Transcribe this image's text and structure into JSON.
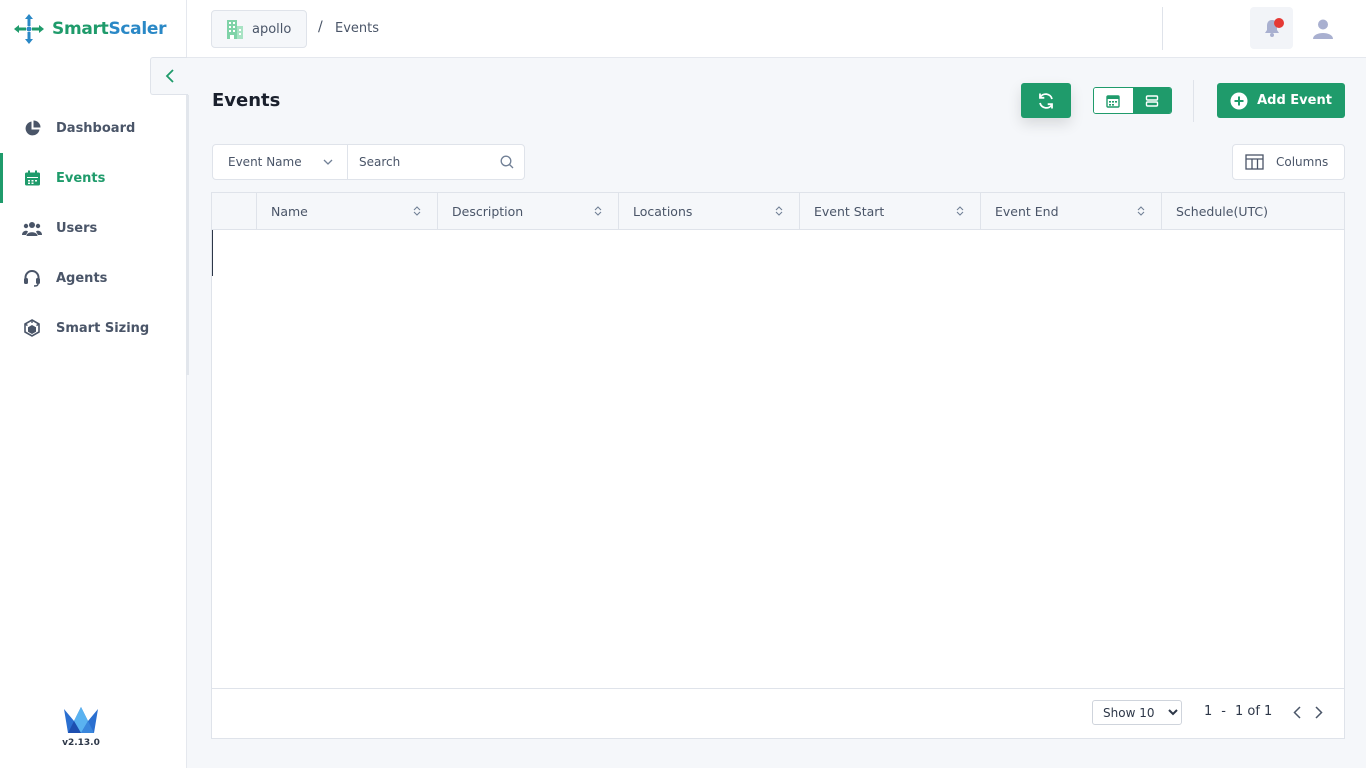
{
  "brand": {
    "part1": "Smart",
    "part2": "Scaler",
    "version": "v2.13.0"
  },
  "sidebar": {
    "items": [
      {
        "label": "Dashboard",
        "icon": "pie-chart-icon",
        "active": false
      },
      {
        "label": "Events",
        "icon": "calendar-icon",
        "active": true
      },
      {
        "label": "Users",
        "icon": "users-icon",
        "active": false
      },
      {
        "label": "Agents",
        "icon": "headset-icon",
        "active": false
      },
      {
        "label": "Smart Sizing",
        "icon": "cube-icon",
        "active": false
      }
    ]
  },
  "header": {
    "org": "apollo",
    "separator": "/",
    "current": "Events"
  },
  "page": {
    "title": "Events",
    "add_label": "Add Event",
    "columns_label": "Columns"
  },
  "filter": {
    "field": "Event Name",
    "search_placeholder": "Search"
  },
  "table": {
    "columns": [
      "Name",
      "Description",
      "Locations",
      "Event Start",
      "Event End",
      "Schedule(UTC)"
    ],
    "rows": []
  },
  "pagination": {
    "show": "Show 10",
    "from": "1",
    "dash": "-",
    "range": "1 of 1"
  },
  "colors": {
    "accent": "#1f9b6b",
    "alert": "#e53935"
  }
}
